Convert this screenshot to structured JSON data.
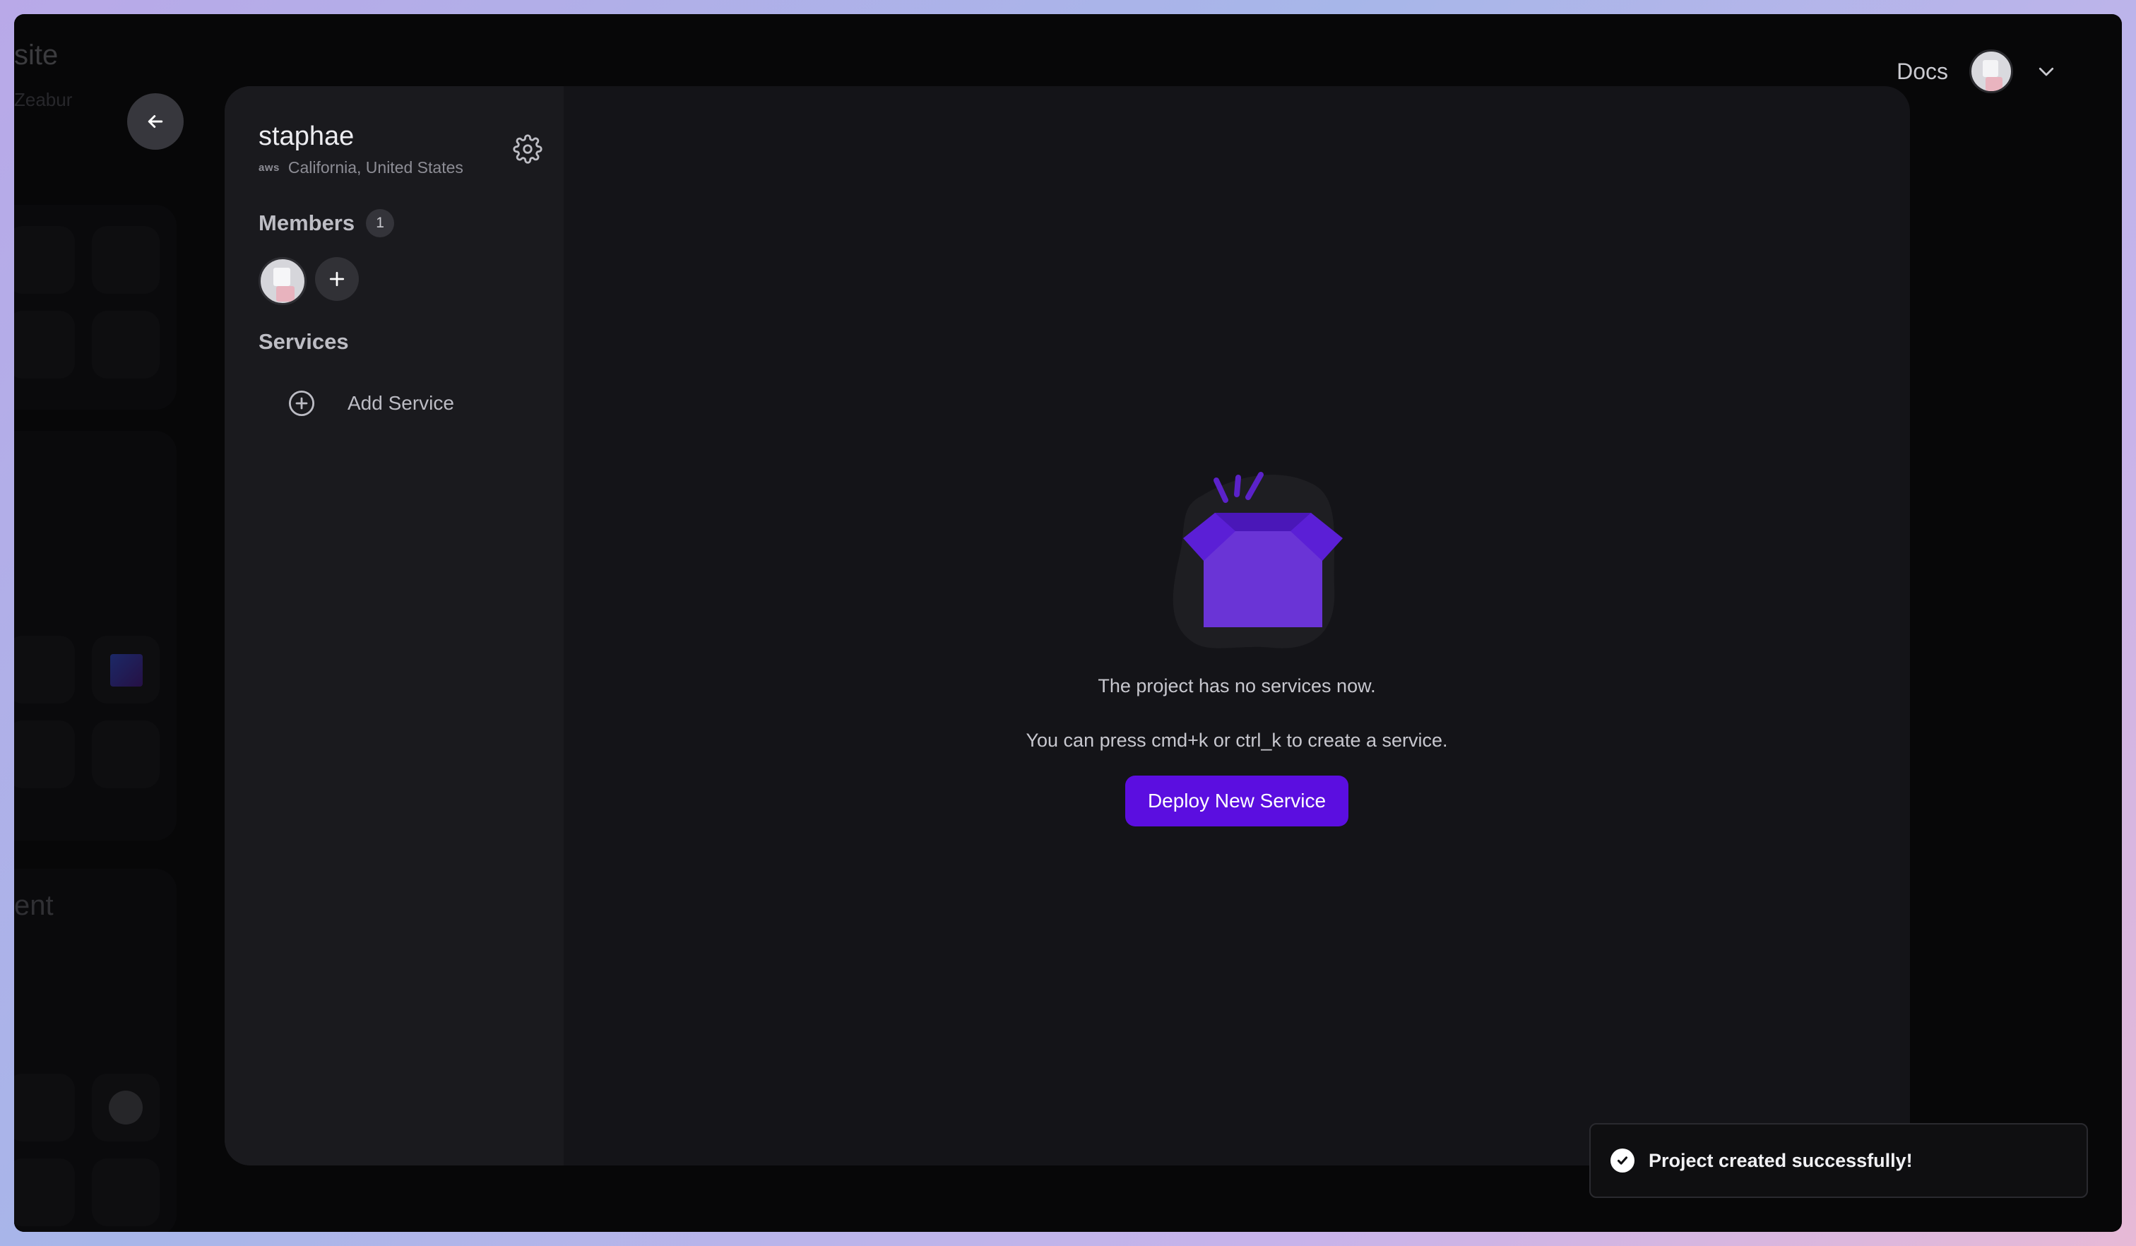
{
  "background": {
    "partial_title": "site",
    "partial_subtitle": "Zeabur",
    "partial_heading": "ent"
  },
  "topbar": {
    "docs_label": "Docs",
    "account_menu_icon": "chevron-down-icon"
  },
  "project": {
    "name": "staphae",
    "provider": "aws",
    "region": "California, United States",
    "settings_icon": "gear-icon"
  },
  "members": {
    "title": "Members",
    "count": "1"
  },
  "services": {
    "title": "Services",
    "add_label": "Add Service"
  },
  "empty_state": {
    "line1": "The project has no services now.",
    "line2": "You can press cmd+k or ctrl_k to create a service.",
    "button_label": "Deploy New Service"
  },
  "toast": {
    "message": "Project created successfully!"
  },
  "colors": {
    "accent": "#5b0ee0",
    "box": "#6a34d6",
    "panel": "#141418",
    "sidebar": "#1a1a1e"
  }
}
